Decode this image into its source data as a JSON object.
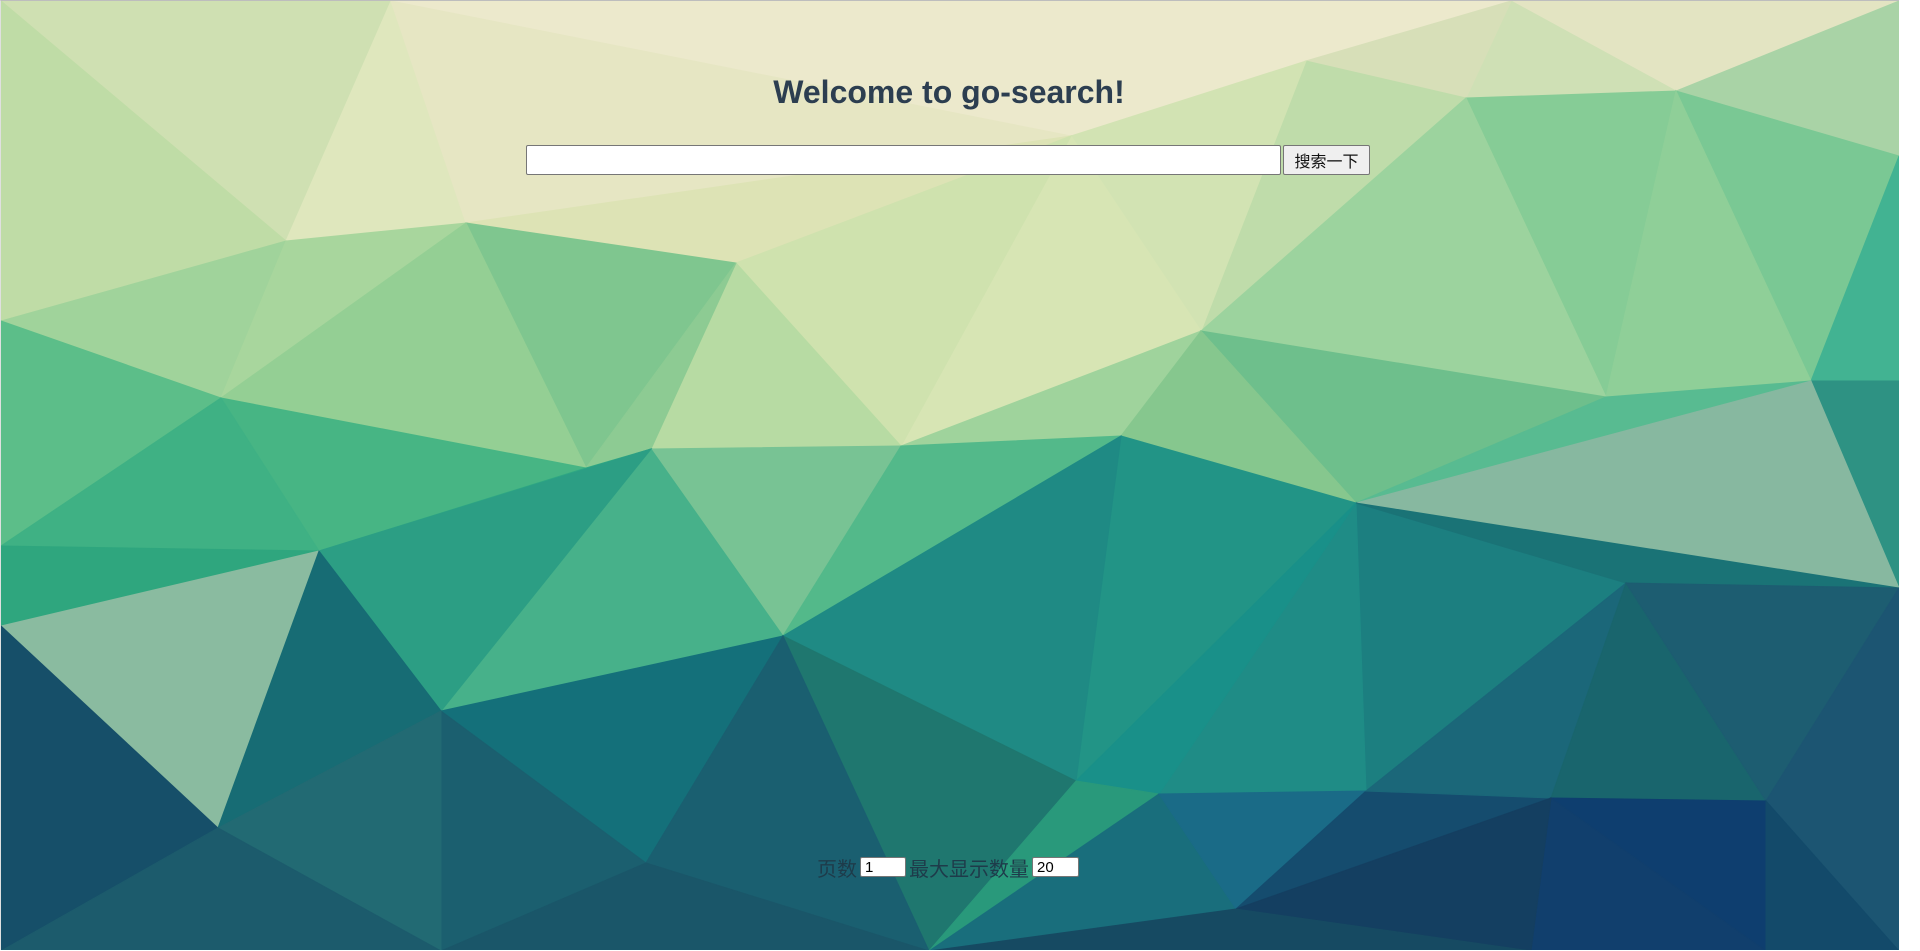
{
  "header": {
    "title": "Welcome to go-search!"
  },
  "search": {
    "value": "",
    "placeholder": "",
    "button_label": "搜索一下"
  },
  "paging": {
    "page_label": "页数",
    "page_value": "1",
    "max_label": "最大显示数量",
    "max_value": "20"
  },
  "background": {
    "style": "low-poly triangles",
    "palette": {
      "top": "#e8e6c4",
      "middle": "#4db889",
      "bottom": "#124a6a"
    }
  }
}
